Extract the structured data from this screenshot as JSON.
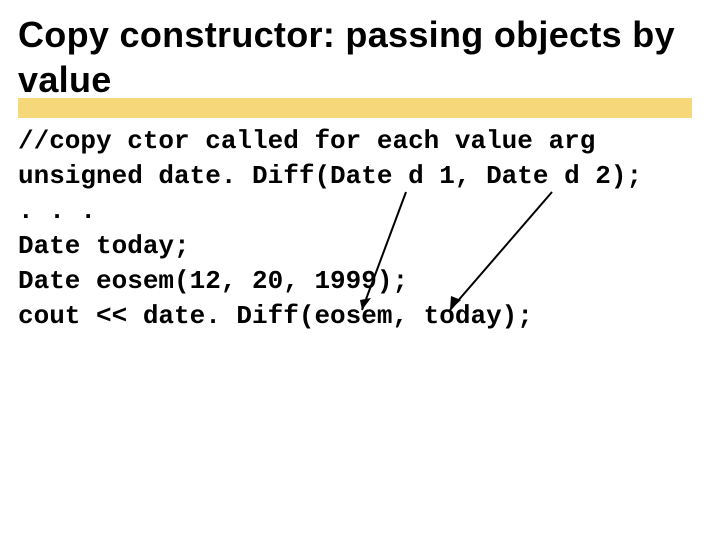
{
  "title": "Copy constructor: passing objects by value",
  "code": {
    "line1": "//copy ctor called for each value arg",
    "line2": "unsigned date. Diff(Date d 1, Date d 2);",
    "line3": ". . .",
    "line4": "Date today;",
    "line5": "Date eosem(12, 20, 1999);",
    "line6": "cout << date. Diff(eosem, today);"
  }
}
